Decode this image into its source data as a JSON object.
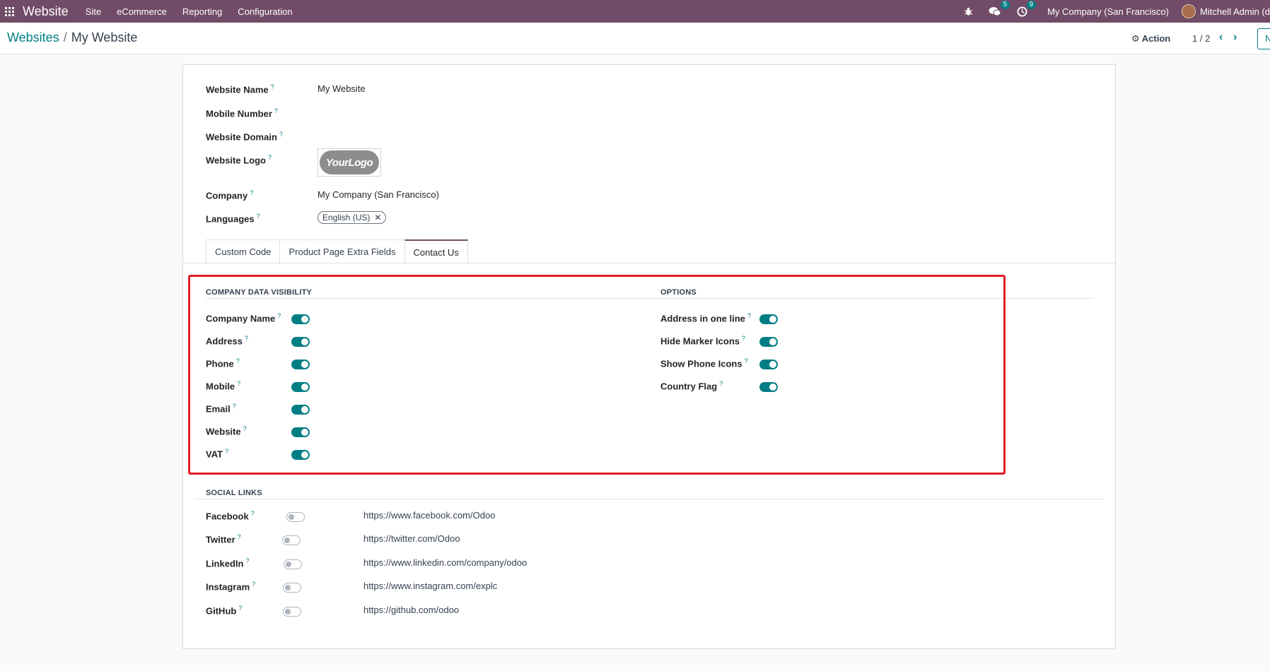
{
  "navbar": {
    "brand": "Website",
    "menu": [
      "Site",
      "eCommerce",
      "Reporting",
      "Configuration"
    ],
    "messages_count": "5",
    "activities_count": "9",
    "company": "My Company (San Francisco)",
    "user": "Mitchell Admin (d"
  },
  "control": {
    "breadcrumb_parent": "Websites",
    "breadcrumb_sep": "/",
    "breadcrumb_current": "My Website",
    "action_label": "Action",
    "pager": "1 / 2",
    "new_label": "N"
  },
  "form": {
    "website_name_label": "Website Name",
    "website_name_value": "My Website",
    "mobile_number_label": "Mobile Number",
    "website_domain_label": "Website Domain",
    "website_logo_label": "Website Logo",
    "logo_text": "YourLogo",
    "company_label": "Company",
    "company_value": "My Company (San Francisco)",
    "languages_label": "Languages",
    "language_tag": "English (US)",
    "help_mark": "?"
  },
  "tabs": [
    "Custom Code",
    "Product Page Extra Fields",
    "Contact Us"
  ],
  "active_tab": "Contact Us",
  "company_visibility": {
    "title": "COMPANY DATA VISIBILITY",
    "items": [
      {
        "label": "Company Name",
        "on": true
      },
      {
        "label": "Address",
        "on": true
      },
      {
        "label": "Phone",
        "on": true
      },
      {
        "label": "Mobile",
        "on": true
      },
      {
        "label": "Email",
        "on": true
      },
      {
        "label": "Website",
        "on": true
      },
      {
        "label": "VAT",
        "on": true
      }
    ]
  },
  "options": {
    "title": "OPTIONS",
    "items": [
      {
        "label": "Address in one line",
        "on": true
      },
      {
        "label": "Hide Marker Icons",
        "on": true
      },
      {
        "label": "Show Phone Icons",
        "on": true
      },
      {
        "label": "Country Flag",
        "on": true
      }
    ]
  },
  "social_links": {
    "title": "SOCIAL LINKS",
    "items": [
      {
        "label": "Facebook",
        "on": false,
        "url": "https://www.facebook.com/Odoo"
      },
      {
        "label": "Twitter",
        "on": false,
        "url": "https://twitter.com/Odoo"
      },
      {
        "label": "LinkedIn",
        "on": false,
        "url": "https://www.linkedin.com/company/odoo"
      },
      {
        "label": "Instagram",
        "on": false,
        "url": "https://www.instagram.com/explc"
      },
      {
        "label": "GitHub",
        "on": false,
        "url": "https://github.com/odoo"
      }
    ]
  },
  "colors": {
    "navbar": "#714b67",
    "accent": "#017e84",
    "highlight": "#e41e26"
  }
}
